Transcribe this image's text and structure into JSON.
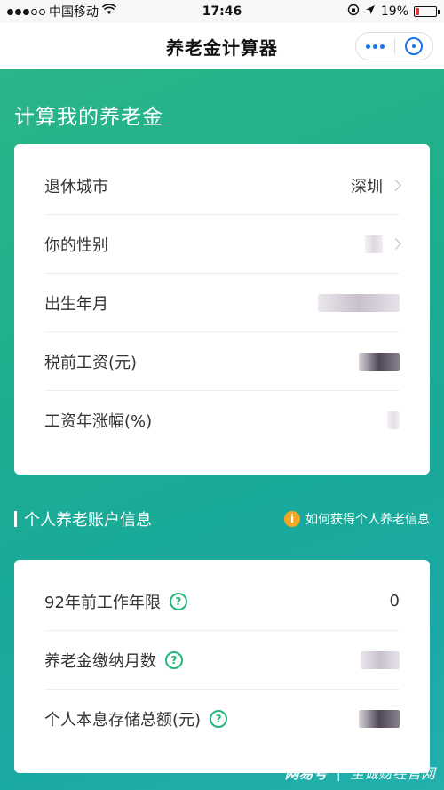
{
  "status_bar": {
    "carrier": "中国移动",
    "time": "17:46",
    "battery": "19%",
    "battery_level": 0.19
  },
  "nav": {
    "title": "养老金计算器"
  },
  "heading": "计算我的养老金",
  "basic_form": {
    "rows": [
      {
        "label": "退休城市",
        "value": "深圳"
      },
      {
        "label": "你的性别",
        "value": ""
      },
      {
        "label": "出生年月",
        "value": ""
      },
      {
        "label": "税前工资(元)",
        "value": ""
      },
      {
        "label": "工资年涨幅(%)",
        "value": ""
      }
    ]
  },
  "section": {
    "title": "个人养老账户信息",
    "help_link": "如何获得个人养老信息"
  },
  "account_form": {
    "rows": [
      {
        "label": "92年前工作年限",
        "value": "0"
      },
      {
        "label": "养老金缴纳月数",
        "value": ""
      },
      {
        "label": "个人本息存储总额(元)",
        "value": ""
      }
    ]
  },
  "watermark": {
    "brand": "网易号",
    "separator": "|",
    "source": "至诚财经官网"
  },
  "colors": {
    "accent_green": "#25b67c",
    "capsule_blue": "#1a73e8",
    "info_orange": "#f5a623",
    "gradient_start": "#2bb58a",
    "gradient_end": "#22b0ad"
  }
}
